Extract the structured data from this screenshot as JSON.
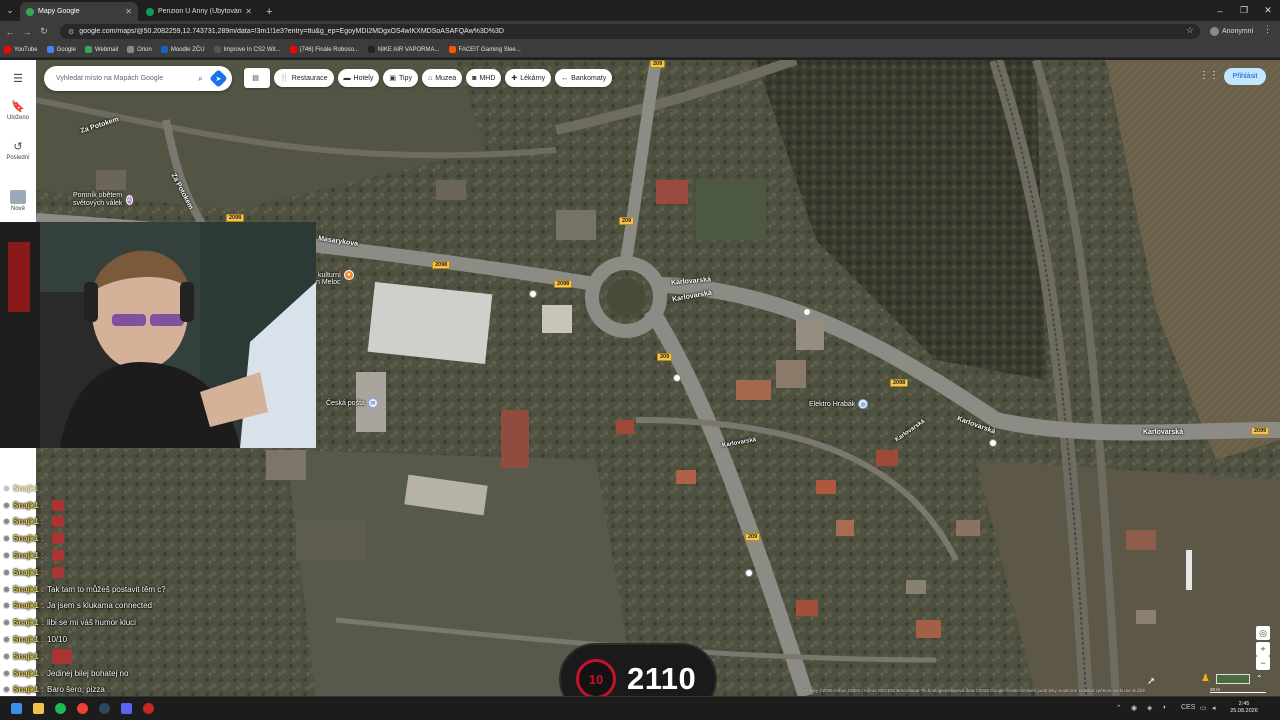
{
  "browser": {
    "tabs": [
      {
        "label": "Mapy Google",
        "favicon_color": "#34a853",
        "active": true
      },
      {
        "label": "Penzion U Anny (Ubytování - p",
        "favicon_color": "#0f9d58",
        "active": false
      }
    ],
    "url": "google.com/maps/@50.2082259,12.743731,289m/data=!3m1!1e3?entry=ttu&g_ep=EgoyMDI2MDgxOS4wIKXMDSoASAFQAw%3D%3D",
    "profile_label": "Anonymní",
    "bookmarks": [
      {
        "label": "YouTube",
        "color": "#ff0000"
      },
      {
        "label": "Google",
        "color": "#4285f4"
      },
      {
        "label": "Webmail",
        "color": "#34a853"
      },
      {
        "label": "Orion",
        "color": "#888888"
      },
      {
        "label": "Moodle ZČU",
        "color": "#1565c0"
      },
      {
        "label": "Improve In CS2 Wit...",
        "color": "#555555"
      },
      {
        "label": "(746) Finále Roboso...",
        "color": "#ff0000"
      },
      {
        "label": "NIKE AIR VAPORMA...",
        "color": "#222222"
      },
      {
        "label": "FACEIT Gaming Slee...",
        "color": "#ff5500"
      }
    ]
  },
  "maps": {
    "search_placeholder": "Vyhledat místo na Mapách Google",
    "rail": [
      {
        "label": "Uloženo",
        "icon": "bookmark-icon"
      },
      {
        "label": "Poslední",
        "icon": "history-icon"
      },
      {
        "label": "Nové",
        "icon": "thumbnail-icon"
      }
    ],
    "chips": [
      {
        "label": "Restaurace",
        "icon": "restaurant-icon",
        "glyph": "🍴"
      },
      {
        "label": "Hotely",
        "icon": "hotel-icon",
        "glyph": "🛏"
      },
      {
        "label": "Tipy",
        "icon": "tips-icon",
        "glyph": "📷"
      },
      {
        "label": "Muzea",
        "icon": "museum-icon",
        "glyph": "🏛"
      },
      {
        "label": "MHD",
        "icon": "transit-icon",
        "glyph": "🚌"
      },
      {
        "label": "Lékárny",
        "icon": "pharmacy-icon",
        "glyph": "✚"
      },
      {
        "label": "Bankomaty",
        "icon": "atm-icon",
        "glyph": "↔"
      }
    ],
    "signin_label": "Přihlásit",
    "street_labels": {
      "za_potokem_1": "Za Potokem",
      "za_potokem_2": "Za Potokem",
      "masarykova": "Masarykova",
      "karlovarska_1": "Karlovarská",
      "karlovarska_2": "Karlovarská",
      "karlovarska_3": "Karlovarská",
      "karlovarska_4": "Karlovarská",
      "karlovarska_5": "Karlovarská",
      "karlovarska_6": "Karlovarská"
    },
    "pois": {
      "pomnik": "Pomník obětem světových válek",
      "kulturni": "kulturní",
      "meloc": "n Meloc",
      "posta": "Česká pošta",
      "elektro": "Elektro Hrabák"
    },
    "road_shields": {
      "s2098": "2098",
      "s2099": "2099",
      "s209": "209"
    },
    "attribution": "Snímky ©2026 Airbus,CNES / Airbus,GEODIS Brno,Maxar Technologies,Mapová data ©2026 Google   Česko   Smluvní podmínky   Soukromí   Odeslat zpětnou vazbu ke službě",
    "scale_label": "20 m"
  },
  "chat": {
    "messages": [
      {
        "user": "Snajk1",
        "text": "",
        "emote": true,
        "faded": true
      },
      {
        "user": "Snajk1",
        "text": "",
        "emote": true
      },
      {
        "user": "Snajk1",
        "text": "",
        "emote": true
      },
      {
        "user": "Snajk1",
        "text": "",
        "emote": true
      },
      {
        "user": "Snajk1",
        "text": "",
        "emote": true
      },
      {
        "user": "Snajk1",
        "text": "",
        "emote": true
      },
      {
        "user": "Snajk1",
        "text": "Tak tam to můžeš postavit těm c?"
      },
      {
        "user": "Snajk1",
        "text": "Ja jsem s klukama connected"
      },
      {
        "user": "Snajk1",
        "text": "libi se mi váš humor kluci"
      },
      {
        "user": "Snajk1",
        "text": "10/10"
      },
      {
        "user": "Snajk1",
        "text": "",
        "emote": true,
        "big": true
      },
      {
        "user": "Snajk1",
        "text": "Jedinej bilej bohatej no"
      },
      {
        "user": "Snajk1",
        "text": "Baro šero, pizza"
      }
    ]
  },
  "score": {
    "level": "10",
    "value": "2110"
  },
  "taskbar": {
    "time": "2:45",
    "date": "25.08.2026",
    "lang": "CES"
  }
}
